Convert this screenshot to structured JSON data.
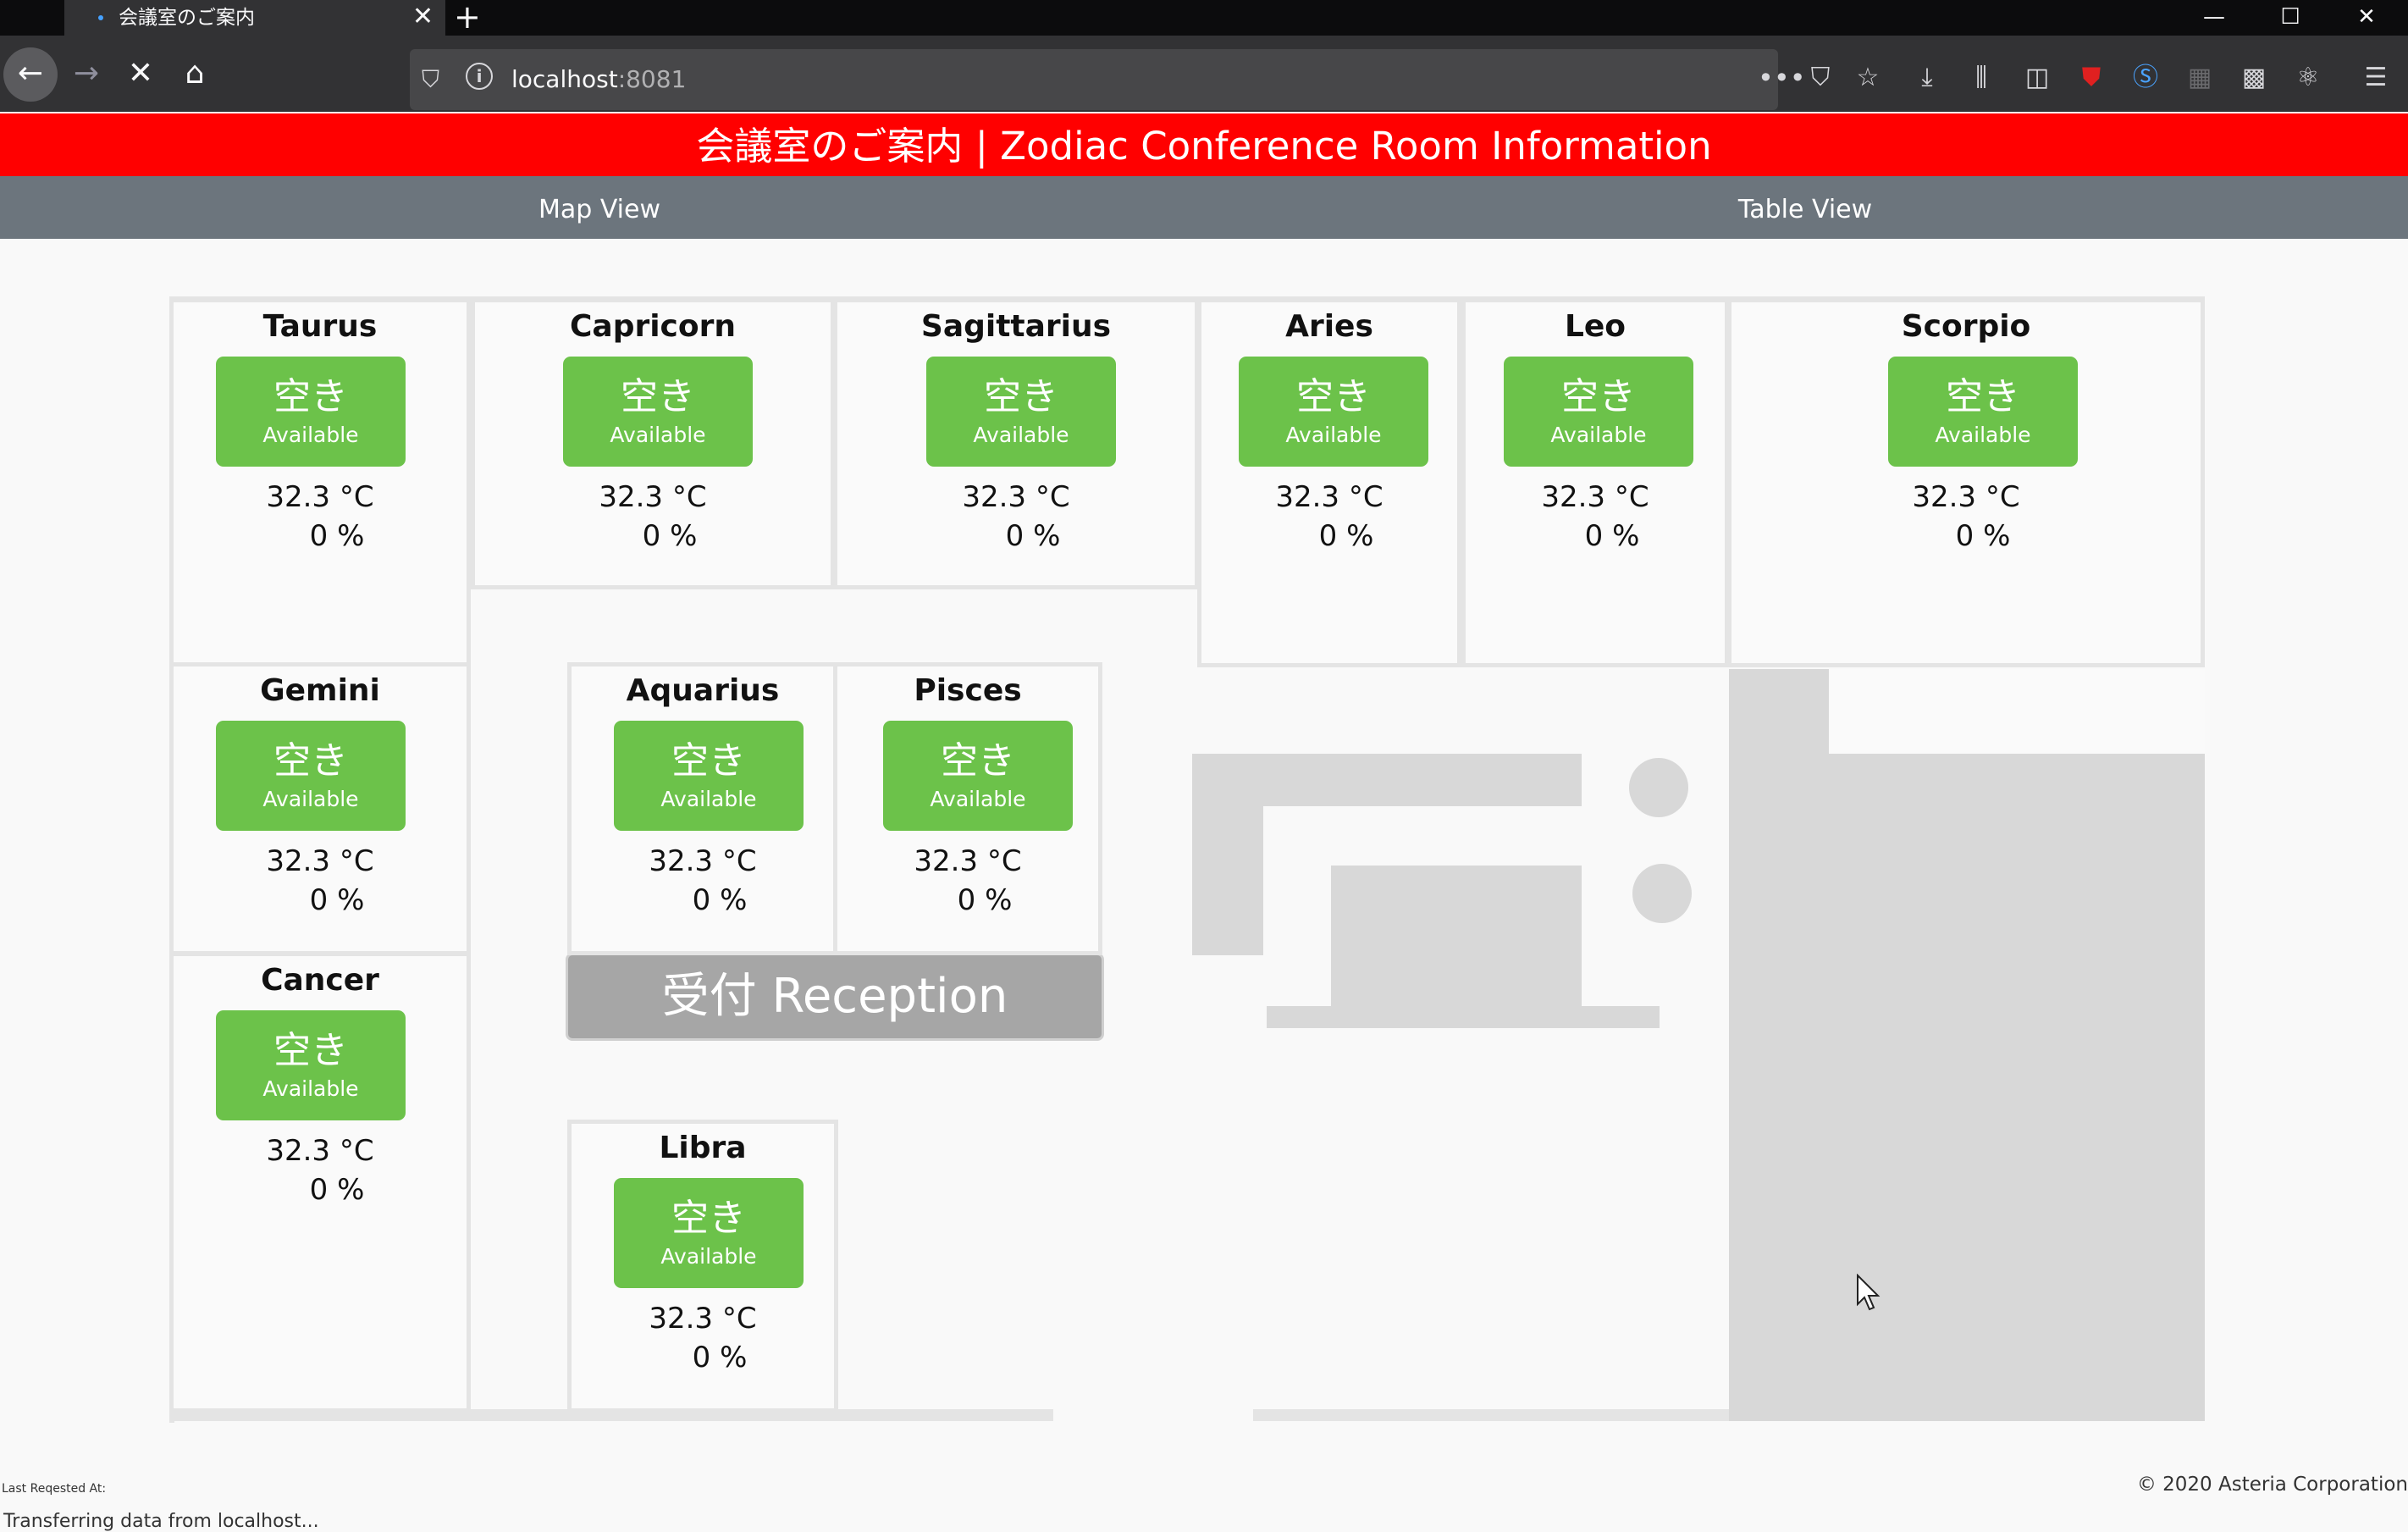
{
  "browser": {
    "tab_title": "会議室のご案内",
    "url_host": "localhost",
    "url_port": ":8081"
  },
  "header": {
    "title": "会議室のご案内 | Zodiac Conference Room Information"
  },
  "nav": {
    "map_view": "Map View",
    "table_view": "Table View"
  },
  "reception": "受付 Reception",
  "rooms": [
    {
      "name": "Taurus",
      "status_jp": "空き",
      "status_en": "Available",
      "temperature": "32.3 °C",
      "humidity": "0 %"
    },
    {
      "name": "Capricorn",
      "status_jp": "空き",
      "status_en": "Available",
      "temperature": "32.3 °C",
      "humidity": "0 %"
    },
    {
      "name": "Sagittarius",
      "status_jp": "空き",
      "status_en": "Available",
      "temperature": "32.3 °C",
      "humidity": "0 %"
    },
    {
      "name": "Aries",
      "status_jp": "空き",
      "status_en": "Available",
      "temperature": "32.3 °C",
      "humidity": "0 %"
    },
    {
      "name": "Leo",
      "status_jp": "空き",
      "status_en": "Available",
      "temperature": "32.3 °C",
      "humidity": "0 %"
    },
    {
      "name": "Scorpio",
      "status_jp": "空き",
      "status_en": "Available",
      "temperature": "32.3 °C",
      "humidity": "0 %"
    },
    {
      "name": "Gemini",
      "status_jp": "空き",
      "status_en": "Available",
      "temperature": "32.3 °C",
      "humidity": "0 %"
    },
    {
      "name": "Aquarius",
      "status_jp": "空き",
      "status_en": "Available",
      "temperature": "32.3 °C",
      "humidity": "0 %"
    },
    {
      "name": "Pisces",
      "status_jp": "空き",
      "status_en": "Available",
      "temperature": "32.3 °C",
      "humidity": "0 %"
    },
    {
      "name": "Cancer",
      "status_jp": "空き",
      "status_en": "Available",
      "temperature": "32.3 °C",
      "humidity": "0 %"
    },
    {
      "name": "Libra",
      "status_jp": "空き",
      "status_en": "Available",
      "temperature": "32.3 °C",
      "humidity": "0 %"
    }
  ],
  "footer": {
    "last_requested": "Last Reqested At:",
    "status_text": "Transferring data from localhost...",
    "copyright": "© 2020 Asteria Corporation"
  },
  "colors": {
    "header": "#ff0000",
    "subnav": "#6c757d",
    "available": "#6cc24a",
    "reception": "#a6a6a6"
  },
  "icons": [
    "back-icon",
    "forward-icon",
    "stop-icon",
    "home-icon",
    "shield-icon",
    "info-icon",
    "more-icon",
    "pocket-icon",
    "bookmark-star-icon",
    "download-icon",
    "library-icon",
    "sidebar-icon",
    "ublock-icon",
    "extension-s-icon",
    "extension-grid-icon",
    "extension-react-icon",
    "menu-icon"
  ]
}
